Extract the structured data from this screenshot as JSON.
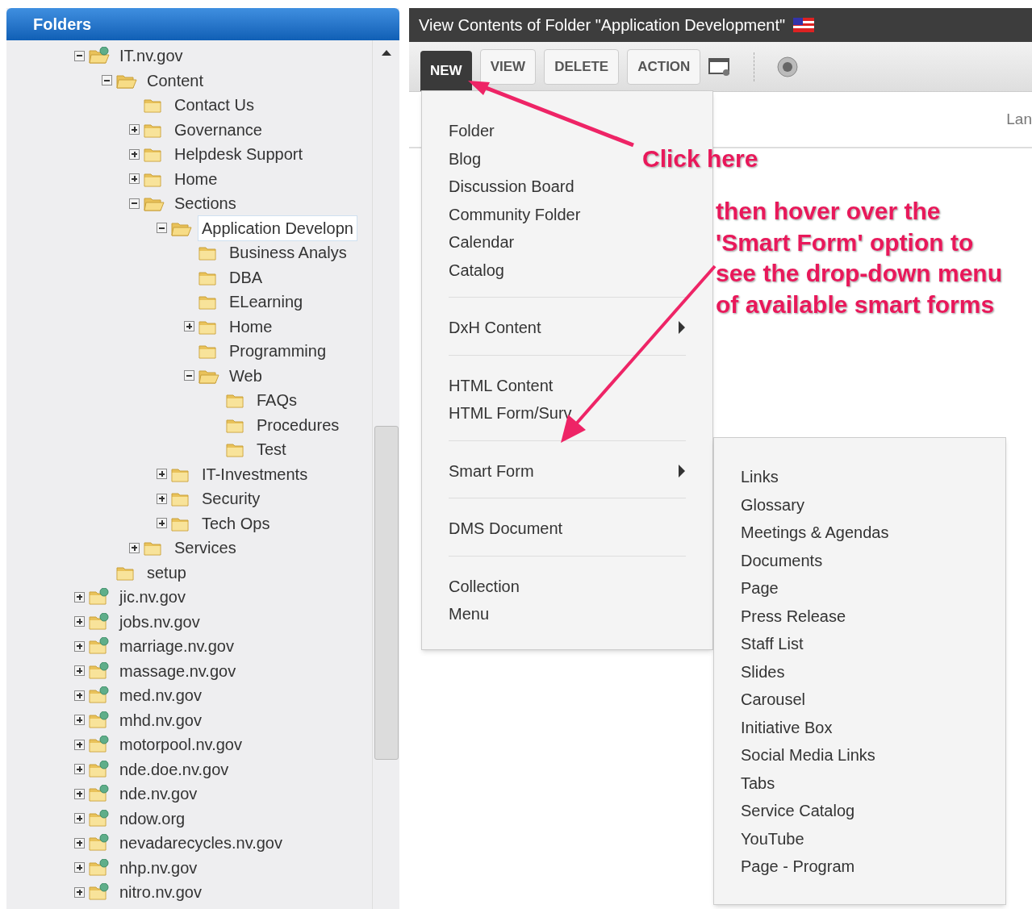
{
  "folders_panel": {
    "title": "Folders",
    "tree": [
      {
        "label": "IT.nv.gov",
        "kind": "site",
        "expanded": true,
        "selected": false,
        "children": [
          {
            "label": "Content",
            "kind": "folder",
            "expanded": true,
            "selected": false,
            "children": [
              {
                "label": "Contact Us",
                "kind": "folder",
                "selected": false
              },
              {
                "label": "Governance",
                "kind": "folder",
                "expanded": false,
                "selected": false
              },
              {
                "label": "Helpdesk Support",
                "kind": "folder",
                "expanded": false,
                "selected": false
              },
              {
                "label": "Home",
                "kind": "folder",
                "expanded": false,
                "selected": false
              },
              {
                "label": "Sections",
                "kind": "folder",
                "expanded": true,
                "selected": false,
                "children": [
                  {
                    "label": "Application Developn",
                    "kind": "folder",
                    "expanded": true,
                    "selected": true,
                    "children": [
                      {
                        "label": "Business Analys",
                        "kind": "folder",
                        "selected": false
                      },
                      {
                        "label": "DBA",
                        "kind": "folder",
                        "selected": false
                      },
                      {
                        "label": "ELearning",
                        "kind": "folder",
                        "selected": false
                      },
                      {
                        "label": "Home",
                        "kind": "folder",
                        "expanded": false,
                        "selected": false
                      },
                      {
                        "label": "Programming",
                        "kind": "folder",
                        "selected": false
                      },
                      {
                        "label": "Web",
                        "kind": "folder",
                        "expanded": true,
                        "selected": false,
                        "children": [
                          {
                            "label": "FAQs",
                            "kind": "folder",
                            "selected": false
                          },
                          {
                            "label": "Procedures",
                            "kind": "folder",
                            "selected": false
                          },
                          {
                            "label": "Test",
                            "kind": "folder",
                            "selected": false
                          }
                        ]
                      }
                    ]
                  },
                  {
                    "label": "IT-Investments",
                    "kind": "folder",
                    "expanded": false,
                    "selected": false
                  },
                  {
                    "label": "Security",
                    "kind": "folder",
                    "expanded": false,
                    "selected": false
                  },
                  {
                    "label": "Tech Ops",
                    "kind": "folder",
                    "expanded": false,
                    "selected": false
                  }
                ]
              },
              {
                "label": "Services",
                "kind": "folder",
                "expanded": false,
                "selected": false
              }
            ]
          },
          {
            "label": "setup",
            "kind": "folder",
            "selected": false
          }
        ]
      },
      {
        "label": "jic.nv.gov",
        "kind": "site",
        "expanded": false,
        "selected": false
      },
      {
        "label": "jobs.nv.gov",
        "kind": "site",
        "expanded": false,
        "selected": false
      },
      {
        "label": "marriage.nv.gov",
        "kind": "site",
        "expanded": false,
        "selected": false
      },
      {
        "label": "massage.nv.gov",
        "kind": "site",
        "expanded": false,
        "selected": false
      },
      {
        "label": "med.nv.gov",
        "kind": "site",
        "expanded": false,
        "selected": false
      },
      {
        "label": "mhd.nv.gov",
        "kind": "site",
        "expanded": false,
        "selected": false
      },
      {
        "label": "motorpool.nv.gov",
        "kind": "site",
        "expanded": false,
        "selected": false
      },
      {
        "label": "nde.doe.nv.gov",
        "kind": "site",
        "expanded": false,
        "selected": false
      },
      {
        "label": "nde.nv.gov",
        "kind": "site",
        "expanded": false,
        "selected": false
      },
      {
        "label": "ndow.org",
        "kind": "site",
        "expanded": false,
        "selected": false
      },
      {
        "label": "nevadarecycles.nv.gov",
        "kind": "site",
        "expanded": false,
        "selected": false
      },
      {
        "label": "nhp.nv.gov",
        "kind": "site",
        "expanded": false,
        "selected": false
      },
      {
        "label": "nitro.nv.gov",
        "kind": "site",
        "expanded": false,
        "selected": false
      }
    ]
  },
  "content_panel": {
    "title": "View Contents of Folder \"Application Development\"",
    "toolbar": [
      {
        "label": "NEW",
        "selected": true
      },
      {
        "label": "VIEW",
        "selected": false
      },
      {
        "label": "DELETE",
        "selected": false
      },
      {
        "label": "ACTION",
        "selected": false
      }
    ],
    "column_1": "Lan",
    "new_menu": [
      [
        {
          "label": "Folder",
          "has_submenu": false
        },
        {
          "label": "Blog",
          "has_submenu": false
        },
        {
          "label": "Discussion Board",
          "has_submenu": false
        },
        {
          "label": "Community Folder",
          "has_submenu": false
        },
        {
          "label": "Calendar",
          "has_submenu": false
        },
        {
          "label": "Catalog",
          "has_submenu": false
        }
      ],
      [
        {
          "label": "DxH Content",
          "has_submenu": true
        }
      ],
      [
        {
          "label": "HTML Content",
          "has_submenu": false
        },
        {
          "label": "HTML Form/Surv",
          "has_submenu": false
        }
      ],
      [
        {
          "label": "Smart Form",
          "has_submenu": true
        }
      ],
      [
        {
          "label": "DMS Document",
          "has_submenu": false
        }
      ],
      [
        {
          "label": "Collection",
          "has_submenu": false
        },
        {
          "label": "Menu",
          "has_submenu": false
        }
      ]
    ],
    "smart_form_menu": [
      "Links",
      "Glossary",
      "Meetings & Agendas",
      "Documents",
      "Page",
      "Press Release",
      "Staff List",
      "Slides",
      "Carousel",
      "Initiative Box",
      "Social Media Links",
      "Tabs",
      "Service Catalog",
      "YouTube",
      "Page - Program"
    ]
  },
  "annotations": {
    "click_note": "Click here",
    "hover_note": "then hover over the 'Smart Form' option to see the drop-down menu of available smart forms"
  }
}
